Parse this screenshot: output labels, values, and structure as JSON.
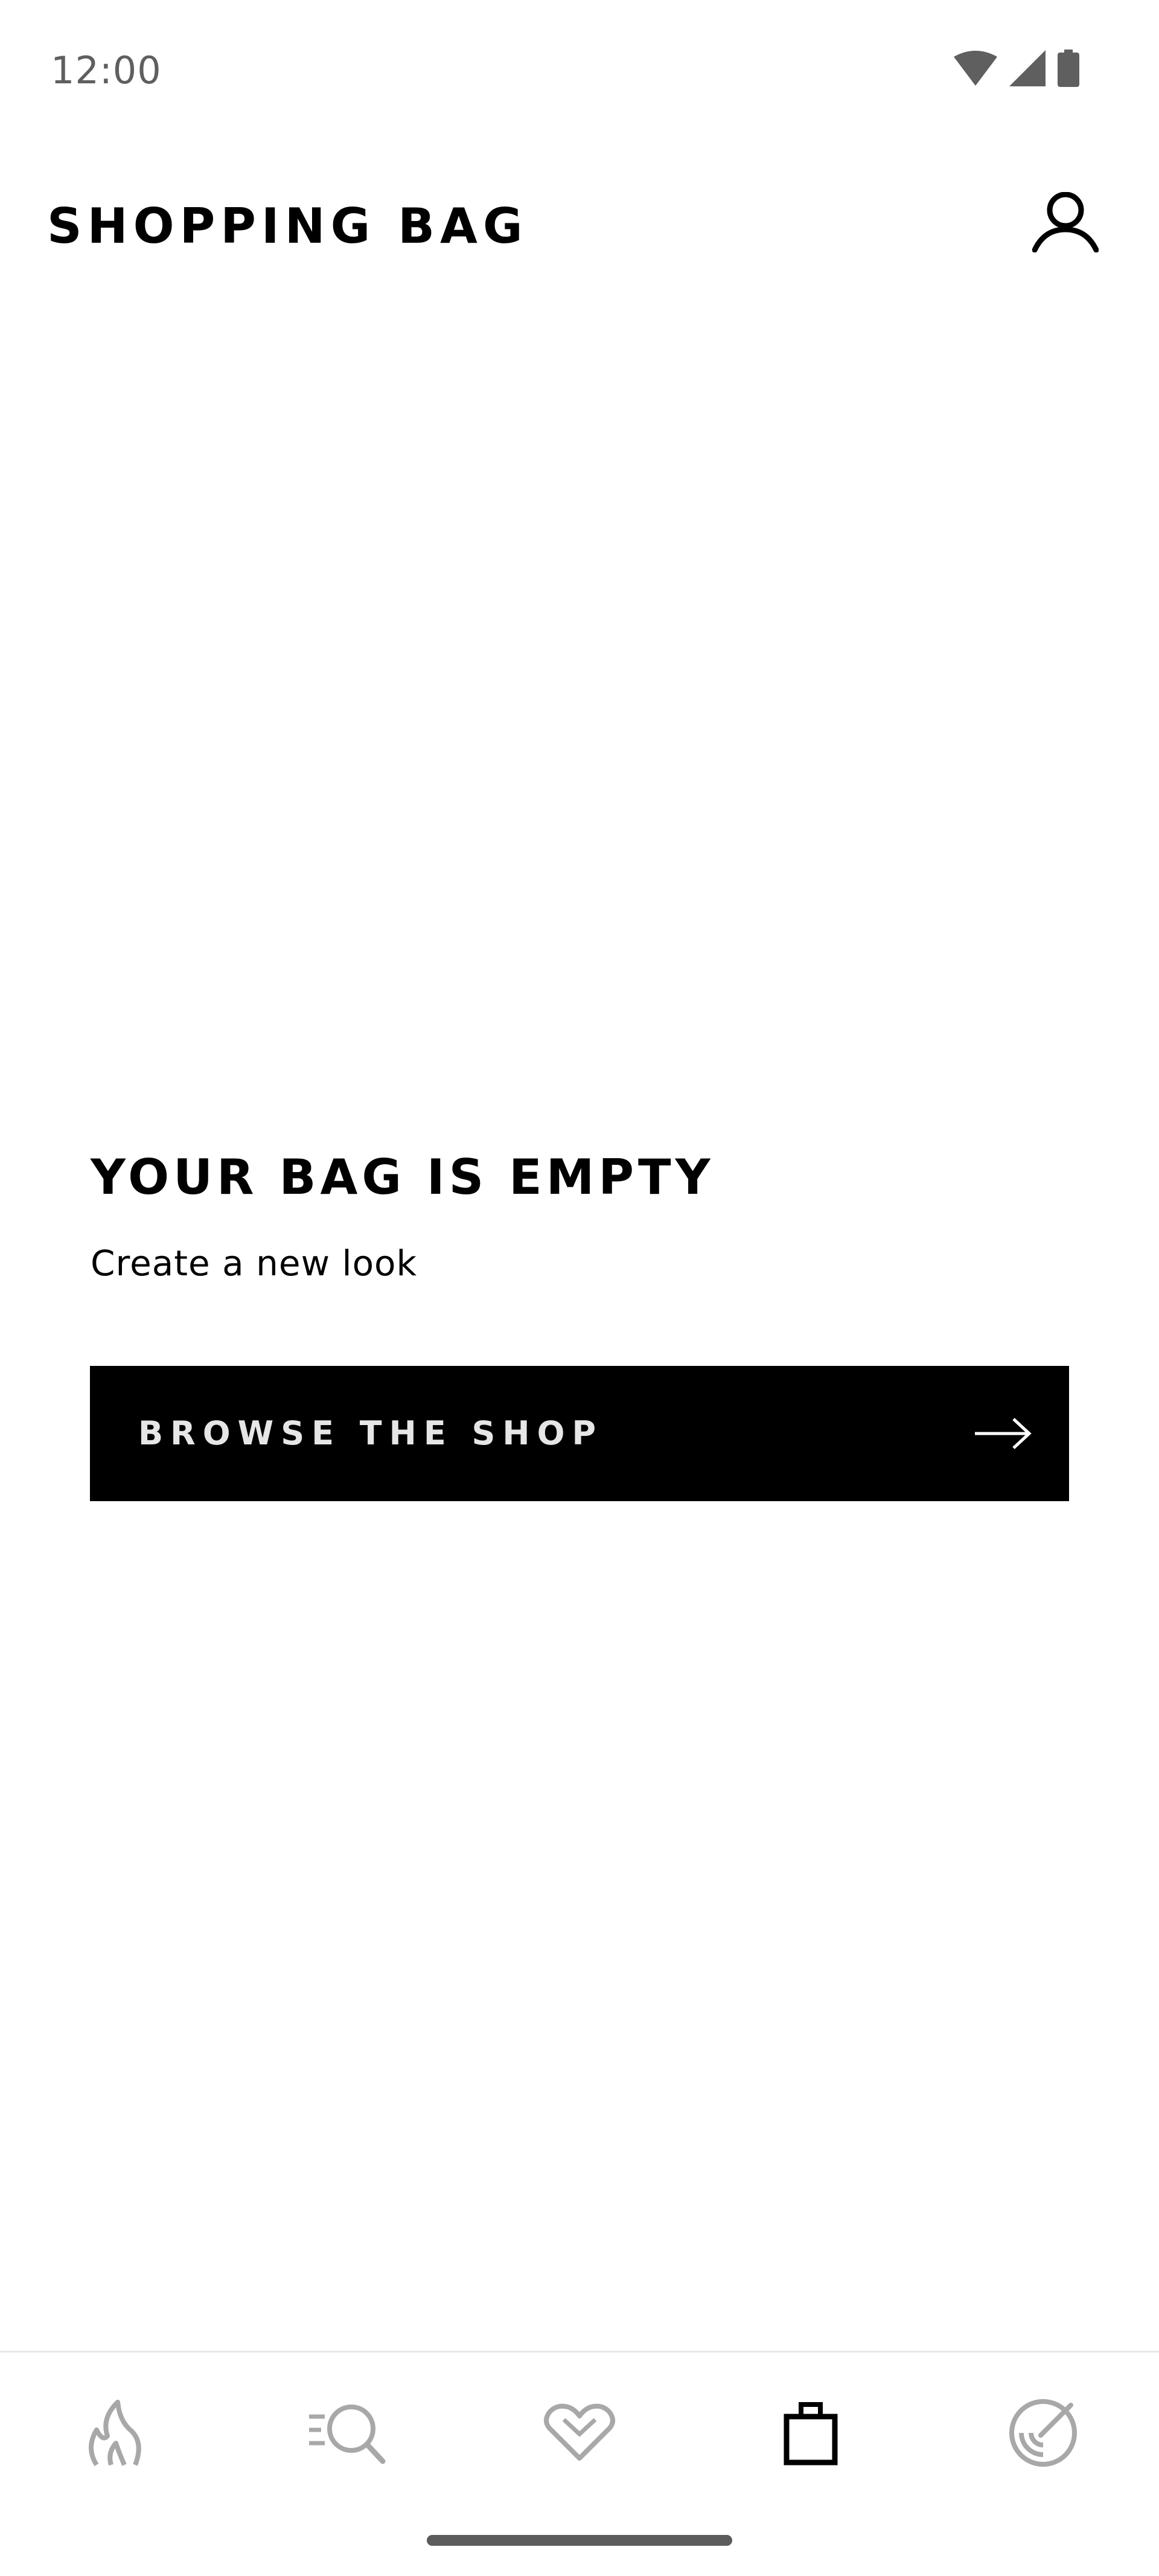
{
  "status_bar": {
    "time": "12:00",
    "icons": [
      "wifi-icon",
      "cellular-signal-icon",
      "battery-icon"
    ]
  },
  "header": {
    "title": "SHOPPING BAG",
    "account_icon": "person-icon"
  },
  "empty_state": {
    "title": "YOUR BAG IS EMPTY",
    "subtitle": "Create a new look",
    "cta_label": "BROWSE THE SHOP",
    "cta_icon": "arrow-right-icon"
  },
  "bottom_nav": {
    "items": [
      {
        "icon": "flame-icon",
        "active": false
      },
      {
        "icon": "search-icon",
        "active": false
      },
      {
        "icon": "heart-icon",
        "active": false
      },
      {
        "icon": "shopping-bag-icon",
        "active": true
      },
      {
        "icon": "radar-icon",
        "active": false
      }
    ],
    "active_color": "#000000",
    "inactive_color": "#a8a8a8"
  },
  "colors": {
    "background": "#ffffff",
    "primary": "#000000",
    "button_text": "#e6e6e6"
  }
}
